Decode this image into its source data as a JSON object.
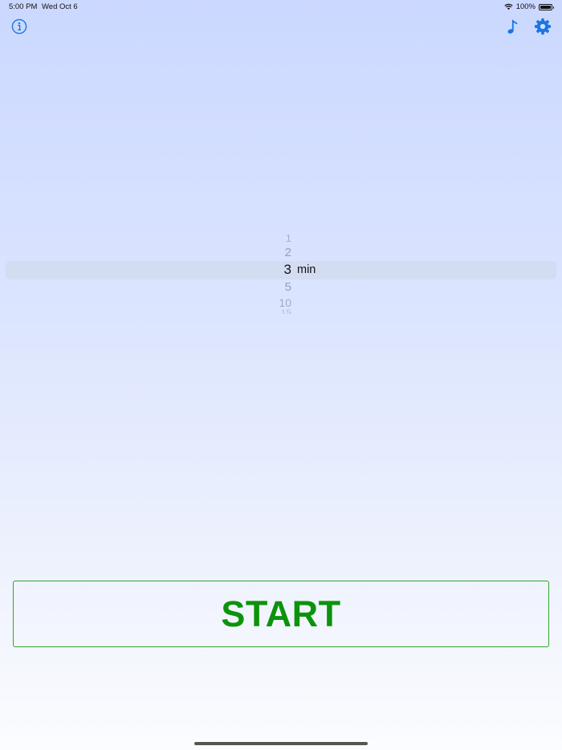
{
  "status_bar": {
    "time": "5:00 PM",
    "date": "Wed Oct 6",
    "battery": "100%"
  },
  "toolbar": {
    "info_icon": "info-circle-icon",
    "music_icon": "music-note-icon",
    "settings_icon": "gear-icon"
  },
  "picker": {
    "options": [
      "1",
      "2",
      "3",
      "5",
      "10",
      "15"
    ],
    "selected": "3",
    "unit": "min"
  },
  "start_button": {
    "label": "START"
  },
  "colors": {
    "accent": "#1877e6",
    "start_green": "#0c930c"
  }
}
